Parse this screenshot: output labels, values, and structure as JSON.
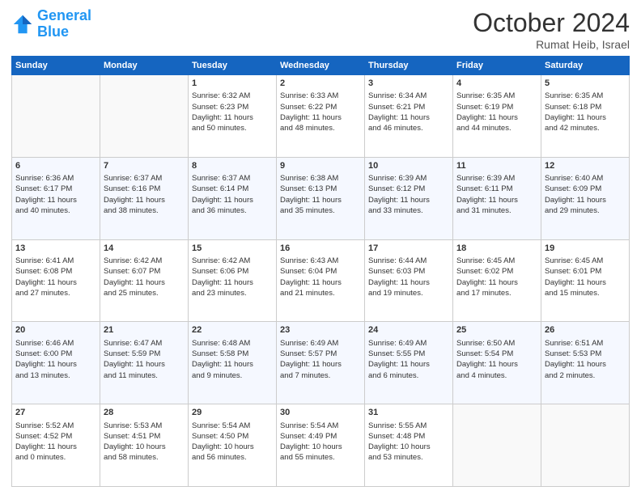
{
  "header": {
    "logo": {
      "line1": "General",
      "line2": "Blue"
    },
    "month": "October 2024",
    "location": "Rumat Heib, Israel"
  },
  "weekdays": [
    "Sunday",
    "Monday",
    "Tuesday",
    "Wednesday",
    "Thursday",
    "Friday",
    "Saturday"
  ],
  "weeks": [
    [
      {
        "day": "",
        "lines": []
      },
      {
        "day": "",
        "lines": []
      },
      {
        "day": "1",
        "lines": [
          "Sunrise: 6:32 AM",
          "Sunset: 6:23 PM",
          "Daylight: 11 hours",
          "and 50 minutes."
        ]
      },
      {
        "day": "2",
        "lines": [
          "Sunrise: 6:33 AM",
          "Sunset: 6:22 PM",
          "Daylight: 11 hours",
          "and 48 minutes."
        ]
      },
      {
        "day": "3",
        "lines": [
          "Sunrise: 6:34 AM",
          "Sunset: 6:21 PM",
          "Daylight: 11 hours",
          "and 46 minutes."
        ]
      },
      {
        "day": "4",
        "lines": [
          "Sunrise: 6:35 AM",
          "Sunset: 6:19 PM",
          "Daylight: 11 hours",
          "and 44 minutes."
        ]
      },
      {
        "day": "5",
        "lines": [
          "Sunrise: 6:35 AM",
          "Sunset: 6:18 PM",
          "Daylight: 11 hours",
          "and 42 minutes."
        ]
      }
    ],
    [
      {
        "day": "6",
        "lines": [
          "Sunrise: 6:36 AM",
          "Sunset: 6:17 PM",
          "Daylight: 11 hours",
          "and 40 minutes."
        ]
      },
      {
        "day": "7",
        "lines": [
          "Sunrise: 6:37 AM",
          "Sunset: 6:16 PM",
          "Daylight: 11 hours",
          "and 38 minutes."
        ]
      },
      {
        "day": "8",
        "lines": [
          "Sunrise: 6:37 AM",
          "Sunset: 6:14 PM",
          "Daylight: 11 hours",
          "and 36 minutes."
        ]
      },
      {
        "day": "9",
        "lines": [
          "Sunrise: 6:38 AM",
          "Sunset: 6:13 PM",
          "Daylight: 11 hours",
          "and 35 minutes."
        ]
      },
      {
        "day": "10",
        "lines": [
          "Sunrise: 6:39 AM",
          "Sunset: 6:12 PM",
          "Daylight: 11 hours",
          "and 33 minutes."
        ]
      },
      {
        "day": "11",
        "lines": [
          "Sunrise: 6:39 AM",
          "Sunset: 6:11 PM",
          "Daylight: 11 hours",
          "and 31 minutes."
        ]
      },
      {
        "day": "12",
        "lines": [
          "Sunrise: 6:40 AM",
          "Sunset: 6:09 PM",
          "Daylight: 11 hours",
          "and 29 minutes."
        ]
      }
    ],
    [
      {
        "day": "13",
        "lines": [
          "Sunrise: 6:41 AM",
          "Sunset: 6:08 PM",
          "Daylight: 11 hours",
          "and 27 minutes."
        ]
      },
      {
        "day": "14",
        "lines": [
          "Sunrise: 6:42 AM",
          "Sunset: 6:07 PM",
          "Daylight: 11 hours",
          "and 25 minutes."
        ]
      },
      {
        "day": "15",
        "lines": [
          "Sunrise: 6:42 AM",
          "Sunset: 6:06 PM",
          "Daylight: 11 hours",
          "and 23 minutes."
        ]
      },
      {
        "day": "16",
        "lines": [
          "Sunrise: 6:43 AM",
          "Sunset: 6:04 PM",
          "Daylight: 11 hours",
          "and 21 minutes."
        ]
      },
      {
        "day": "17",
        "lines": [
          "Sunrise: 6:44 AM",
          "Sunset: 6:03 PM",
          "Daylight: 11 hours",
          "and 19 minutes."
        ]
      },
      {
        "day": "18",
        "lines": [
          "Sunrise: 6:45 AM",
          "Sunset: 6:02 PM",
          "Daylight: 11 hours",
          "and 17 minutes."
        ]
      },
      {
        "day": "19",
        "lines": [
          "Sunrise: 6:45 AM",
          "Sunset: 6:01 PM",
          "Daylight: 11 hours",
          "and 15 minutes."
        ]
      }
    ],
    [
      {
        "day": "20",
        "lines": [
          "Sunrise: 6:46 AM",
          "Sunset: 6:00 PM",
          "Daylight: 11 hours",
          "and 13 minutes."
        ]
      },
      {
        "day": "21",
        "lines": [
          "Sunrise: 6:47 AM",
          "Sunset: 5:59 PM",
          "Daylight: 11 hours",
          "and 11 minutes."
        ]
      },
      {
        "day": "22",
        "lines": [
          "Sunrise: 6:48 AM",
          "Sunset: 5:58 PM",
          "Daylight: 11 hours",
          "and 9 minutes."
        ]
      },
      {
        "day": "23",
        "lines": [
          "Sunrise: 6:49 AM",
          "Sunset: 5:57 PM",
          "Daylight: 11 hours",
          "and 7 minutes."
        ]
      },
      {
        "day": "24",
        "lines": [
          "Sunrise: 6:49 AM",
          "Sunset: 5:55 PM",
          "Daylight: 11 hours",
          "and 6 minutes."
        ]
      },
      {
        "day": "25",
        "lines": [
          "Sunrise: 6:50 AM",
          "Sunset: 5:54 PM",
          "Daylight: 11 hours",
          "and 4 minutes."
        ]
      },
      {
        "day": "26",
        "lines": [
          "Sunrise: 6:51 AM",
          "Sunset: 5:53 PM",
          "Daylight: 11 hours",
          "and 2 minutes."
        ]
      }
    ],
    [
      {
        "day": "27",
        "lines": [
          "Sunrise: 5:52 AM",
          "Sunset: 4:52 PM",
          "Daylight: 11 hours",
          "and 0 minutes."
        ]
      },
      {
        "day": "28",
        "lines": [
          "Sunrise: 5:53 AM",
          "Sunset: 4:51 PM",
          "Daylight: 10 hours",
          "and 58 minutes."
        ]
      },
      {
        "day": "29",
        "lines": [
          "Sunrise: 5:54 AM",
          "Sunset: 4:50 PM",
          "Daylight: 10 hours",
          "and 56 minutes."
        ]
      },
      {
        "day": "30",
        "lines": [
          "Sunrise: 5:54 AM",
          "Sunset: 4:49 PM",
          "Daylight: 10 hours",
          "and 55 minutes."
        ]
      },
      {
        "day": "31",
        "lines": [
          "Sunrise: 5:55 AM",
          "Sunset: 4:48 PM",
          "Daylight: 10 hours",
          "and 53 minutes."
        ]
      },
      {
        "day": "",
        "lines": []
      },
      {
        "day": "",
        "lines": []
      }
    ]
  ]
}
